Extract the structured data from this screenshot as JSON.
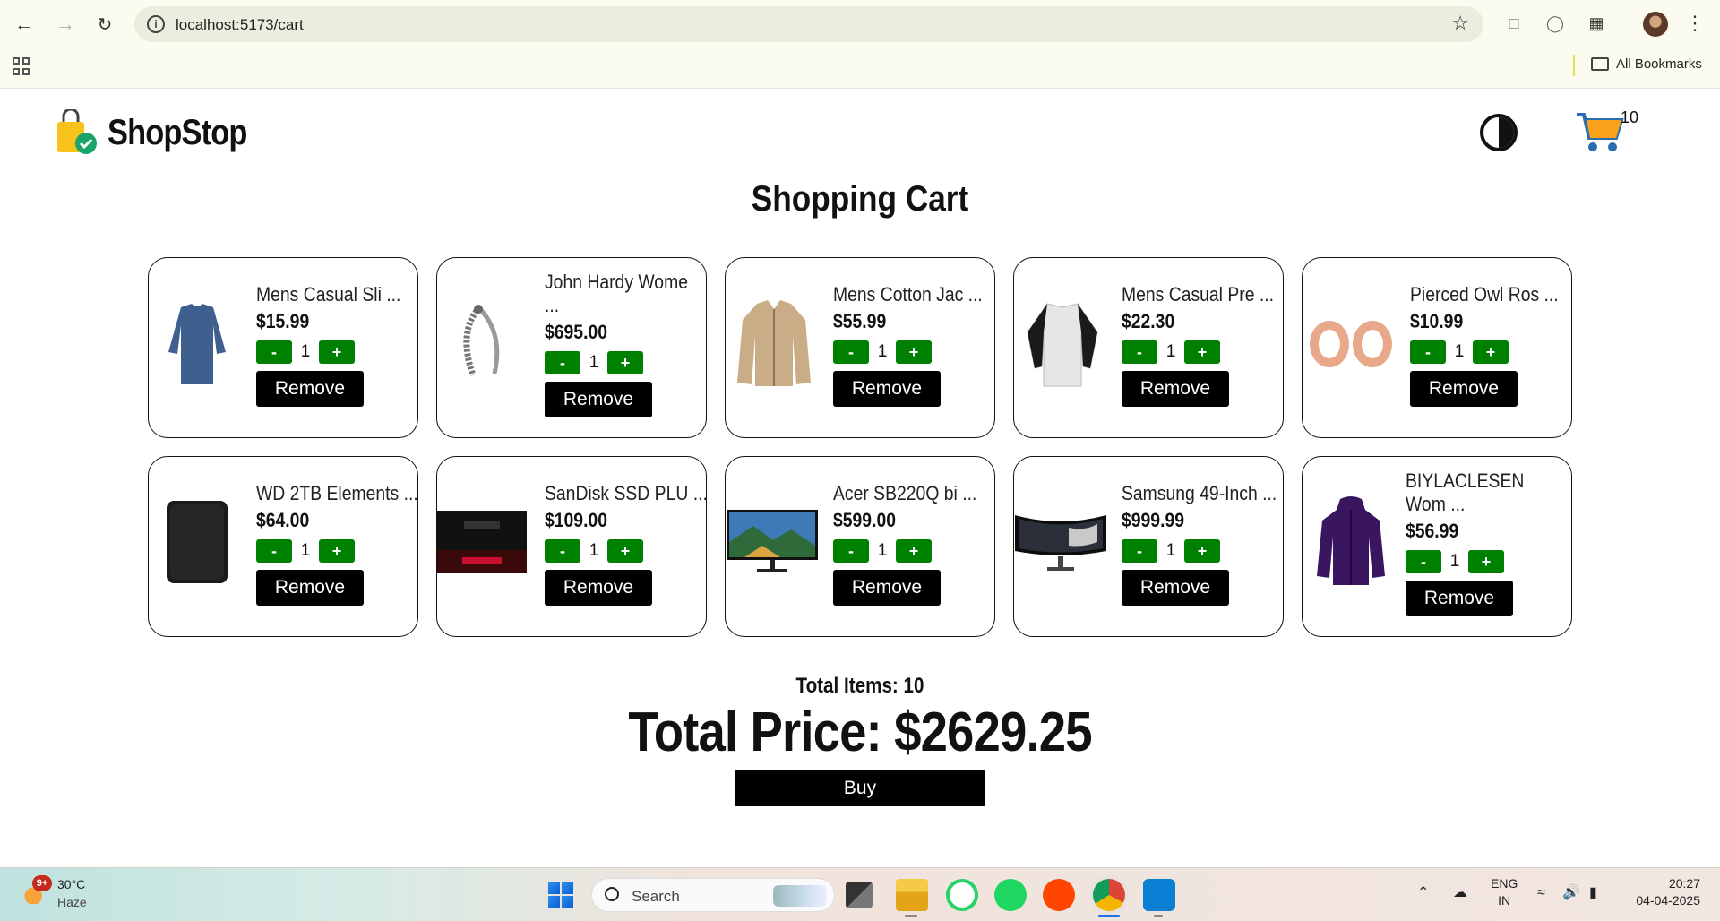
{
  "browser": {
    "url": "localhost:5173/cart",
    "bookmarks_label": "All Bookmarks"
  },
  "header": {
    "brand": "ShopStop",
    "cart_count": "10"
  },
  "page_title": "Shopping Cart",
  "cart_items": [
    {
      "name": "Mens Casual Sli ...",
      "price": "$15.99",
      "qty": "1",
      "image": "blue-shirt"
    },
    {
      "name": "John Hardy Wome ...",
      "price": "$695.00",
      "qty": "1",
      "image": "silver-bracelet"
    },
    {
      "name": "Mens Cotton Jac ...",
      "price": "$55.99",
      "qty": "1",
      "image": "beige-jacket"
    },
    {
      "name": "Mens Casual Pre ...",
      "price": "$22.30",
      "qty": "1",
      "image": "raglan-tee"
    },
    {
      "name": "Pierced Owl Ros ...",
      "price": "$10.99",
      "qty": "1",
      "image": "rose-gold-plugs"
    },
    {
      "name": "WD 2TB Elements ...",
      "price": "$64.00",
      "qty": "1",
      "image": "hard-drive"
    },
    {
      "name": "SanDisk SSD PLU ...",
      "price": "$109.00",
      "qty": "1",
      "image": "ssd"
    },
    {
      "name": "Acer SB220Q bi ...",
      "price": "$599.00",
      "qty": "1",
      "image": "monitor"
    },
    {
      "name": "Samsung 49-Inch ...",
      "price": "$999.99",
      "qty": "1",
      "image": "ultrawide-monitor"
    },
    {
      "name": "BIYLACLESEN Wom ...",
      "price": "$56.99",
      "qty": "1",
      "image": "purple-jacket"
    }
  ],
  "labels": {
    "minus": "-",
    "plus": "+",
    "remove": "Remove",
    "buy": "Buy"
  },
  "totals": {
    "items": "Total Items: 10",
    "price": "Total Price: $2629.25"
  },
  "taskbar": {
    "weather_badge": "9+",
    "temperature": "30°C",
    "condition": "Haze",
    "search_label": "Search",
    "lang_line1": "ENG",
    "lang_line2": "IN",
    "time": "20:27",
    "date": "04-04-2025"
  },
  "colors": {
    "qty_button": "#008000",
    "remove_button": "#000000",
    "cart_icon": "#f7a21a"
  }
}
